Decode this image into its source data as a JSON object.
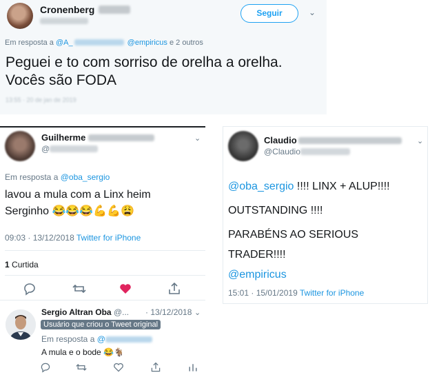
{
  "colors": {
    "link": "#1da1f2",
    "muted": "#657786",
    "heart": "#e0245e"
  },
  "card1": {
    "author_name": "Cronenberg",
    "follow_label": "Seguir",
    "reply_prefix": "Em resposta a",
    "reply_mention_1": "@A_",
    "reply_mention_2": "@empiricus",
    "reply_suffix": "e 2 outros",
    "text_line1": "Peguei e to com sorriso de orelha a orelha.",
    "text_line2": "Vocês são FODA"
  },
  "card2": {
    "author_name": "Guilherme",
    "handle_prefix": "@",
    "reply_prefix": "Em resposta a",
    "reply_mention": "@oba_sergio",
    "text_line1": "lavou a mula com a Linx heim",
    "text_line2": "Serginho 😂😂😂💪💪😩",
    "time": "09:03 · 13/12/2018",
    "client": "Twitter for iPhone",
    "likes_count": "1",
    "likes_label": "Curtida",
    "reply": {
      "author_name": "Sergio Altran Oba",
      "handle": "@...",
      "date": "· 13/12/2018",
      "badge": "Usuário que criou o Tweet original",
      "reply_prefix": "Em resposta a",
      "reply_mention": "@",
      "text": "A mula e o bode 😂🐐"
    },
    "icons": [
      "reply-icon",
      "retweet-icon",
      "heart-icon",
      "share-icon",
      "analytics-icon"
    ]
  },
  "card3": {
    "author_name": "Claudio",
    "handle_prefix": "@Claudio",
    "mention": "@oba_sergio",
    "text_a": "!!!! LINX + ALUP!!!!",
    "line2": "OUTSTANDING !!!!",
    "line3": "PARABÉNS AO SERIOUS",
    "line4": "TRADER!!!!",
    "line5": "@empiricus",
    "time": "15:01 · 15/01/2019",
    "client": "Twitter for iPhone"
  }
}
